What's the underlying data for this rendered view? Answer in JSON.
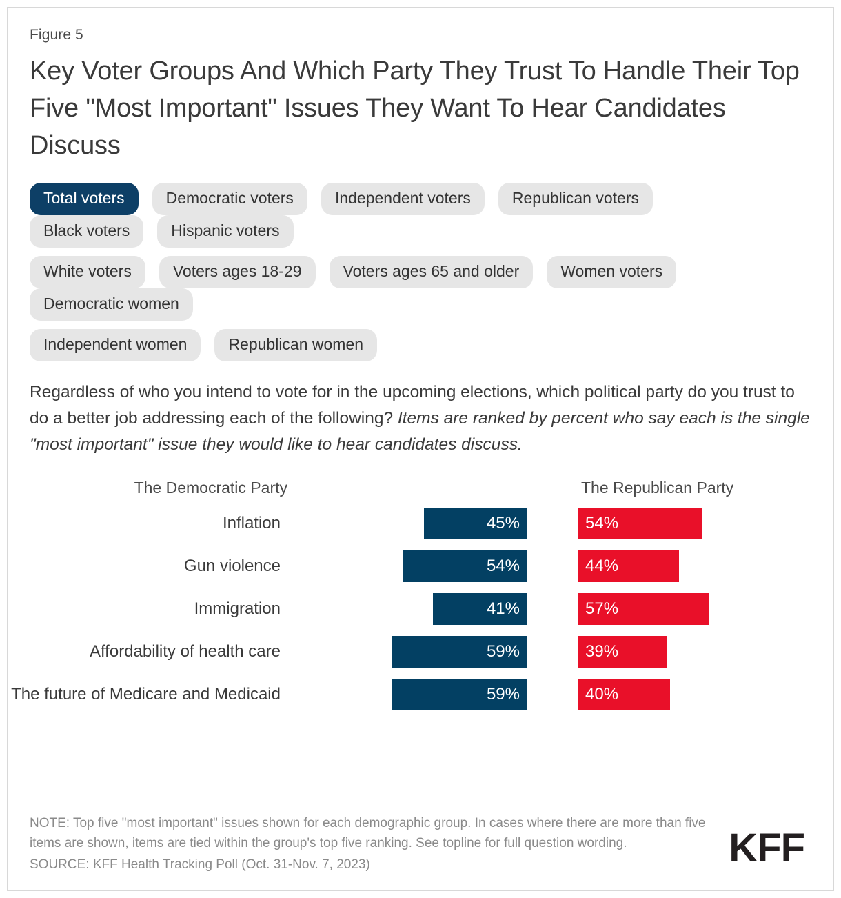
{
  "figure_label": "Figure 5",
  "title": "Key Voter Groups And Which Party They Trust To Handle Their Top Five \"Most Important\" Issues They Want To Hear Candidates Discuss",
  "tab_groups": [
    [
      {
        "label": "Total voters",
        "active": true
      },
      {
        "label": "Democratic voters",
        "active": false
      },
      {
        "label": "Independent voters",
        "active": false
      },
      {
        "label": "Republican voters",
        "active": false
      },
      {
        "label": "Black voters",
        "active": false
      },
      {
        "label": "Hispanic voters",
        "active": false
      }
    ],
    [
      {
        "label": "White voters",
        "active": false
      },
      {
        "label": "Voters ages 18-29",
        "active": false
      },
      {
        "label": "Voters ages 65 and older",
        "active": false
      },
      {
        "label": "Women voters",
        "active": false
      },
      {
        "label": "Democratic women",
        "active": false
      }
    ],
    [
      {
        "label": "Independent women",
        "active": false
      },
      {
        "label": "Republican women",
        "active": false
      }
    ]
  ],
  "question_plain": "Regardless of who you intend to vote for in the upcoming elections, which political party do you trust to do a better job addressing each of the following? ",
  "question_italic": "Items are ranked by percent who say each is the single \"most important\" issue they would like to hear candidates discuss.",
  "note": "NOTE: Top five \"most important\" issues shown for each demographic group. In cases where there are more than five items are shown, items are tied within the group's top five ranking. See topline for full question wording.",
  "source": "SOURCE: KFF Health Tracking Poll (Oct. 31-Nov. 7, 2023)",
  "logo": "KFF",
  "colors": {
    "democratic": "#034063",
    "republican": "#e91029",
    "active_tab": "#0d3f66",
    "tab": "#e6e6e6"
  },
  "chart_data": {
    "type": "bar",
    "title": "Key Voter Groups And Which Party They Trust To Handle Their Top Five \"Most Important\" Issues They Want To Hear Candidates Discuss",
    "subtitle": "Total voters",
    "xlabel": "",
    "ylabel": "",
    "orientation": "horizontal",
    "layout": "diverging-paired",
    "grid": false,
    "legend_position": "top",
    "value_suffix": "%",
    "xlim": [
      0,
      100
    ],
    "categories": [
      "Inflation",
      "Gun violence",
      "Immigration",
      "Affordability of health care",
      "The future of Medicare and Medicaid"
    ],
    "series": [
      {
        "name": "The Democratic Party",
        "color": "#034063",
        "values": [
          45,
          54,
          41,
          59,
          59
        ],
        "labels": [
          "45%",
          "54%",
          "41%",
          "59%",
          "59%"
        ]
      },
      {
        "name": "The Republican Party",
        "color": "#e91029",
        "values": [
          54,
          44,
          57,
          39,
          40
        ],
        "labels": [
          "54%",
          "44%",
          "57%",
          "39%",
          "40%"
        ]
      }
    ]
  }
}
